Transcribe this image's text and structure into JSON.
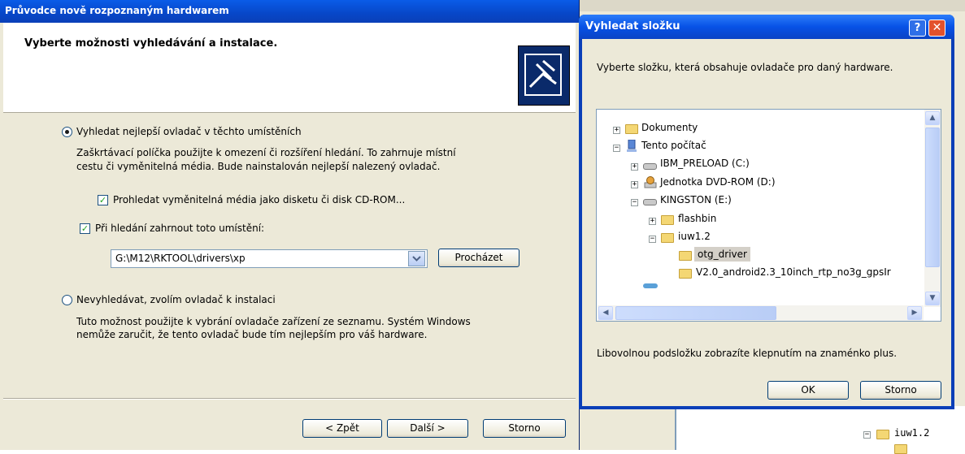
{
  "wizard": {
    "title": "Průvodce nově rozpoznaným hardwarem",
    "heading": "Vyberte možnosti vyhledávání a instalace.",
    "option_search": {
      "label": "Vyhledat nejlepší ovladač v těchto umístěních",
      "description_line1": "Zaškrtávací políčka použijte k omezení či rozšíření hledání. To zahrnuje místní",
      "description_line2": "cestu či vyměnitelná média. Bude nainstalován nejlepší nalezený ovladač.",
      "selected": true
    },
    "checkbox_removable": {
      "label": "Prohledat vyměnitelná média jako disketu či disk CD-ROM...",
      "checked": true
    },
    "checkbox_location": {
      "label": "Při hledání zahrnout toto umístění:",
      "checked": true
    },
    "path_value": "G:\\M12\\RKTOOL\\drivers\\xp",
    "browse_label": "Procházet",
    "option_manual": {
      "label": "Nevyhledávat, zvolím ovladač k instalaci",
      "description_line1": "Tuto možnost použijte k vybrání ovladače zařízení ze seznamu. Systém Windows",
      "description_line2": "nemůže zaručit, že tento ovladač bude tím nejlepším pro váš hardware.",
      "selected": false
    },
    "back_label": "< Zpět",
    "next_label": "Další >",
    "cancel_label": "Storno"
  },
  "browse_dialog": {
    "title": "Vyhledat složku",
    "help_glyph": "?",
    "close_glyph": "✕",
    "instruction": "Vyberte složku, která obsahuje ovladače pro daný hardware.",
    "tree": [
      {
        "label": "Dokumenty",
        "expander": "+",
        "icon": "folder-icon"
      },
      {
        "label": "Tento počítač",
        "expander": "−",
        "icon": "computer-icon"
      },
      {
        "label": "IBM_PRELOAD (C:)",
        "expander": "+",
        "icon": "drive-icon"
      },
      {
        "label": "Jednotka DVD-ROM (D:)",
        "expander": "+",
        "icon": "dvd-drive-icon"
      },
      {
        "label": "KINGSTON (E:)",
        "expander": "−",
        "icon": "drive-icon"
      },
      {
        "label": "flashbin",
        "expander": "+",
        "icon": "folder-icon"
      },
      {
        "label": "iuw1.2",
        "expander": "−",
        "icon": "folder-icon"
      },
      {
        "label": "otg_driver",
        "expander": "",
        "icon": "folder-icon",
        "selected": true
      },
      {
        "label": "V2.0_android2.3_10inch_rtp_no3g_gpsIr",
        "expander": "",
        "icon": "folder-icon"
      }
    ],
    "hint": "Libovolnou podsložku zobrazíte klepnutím na znaménko plus.",
    "ok_label": "OK",
    "cancel_label": "Storno"
  },
  "background": {
    "tree_item": "iuw1.2"
  }
}
